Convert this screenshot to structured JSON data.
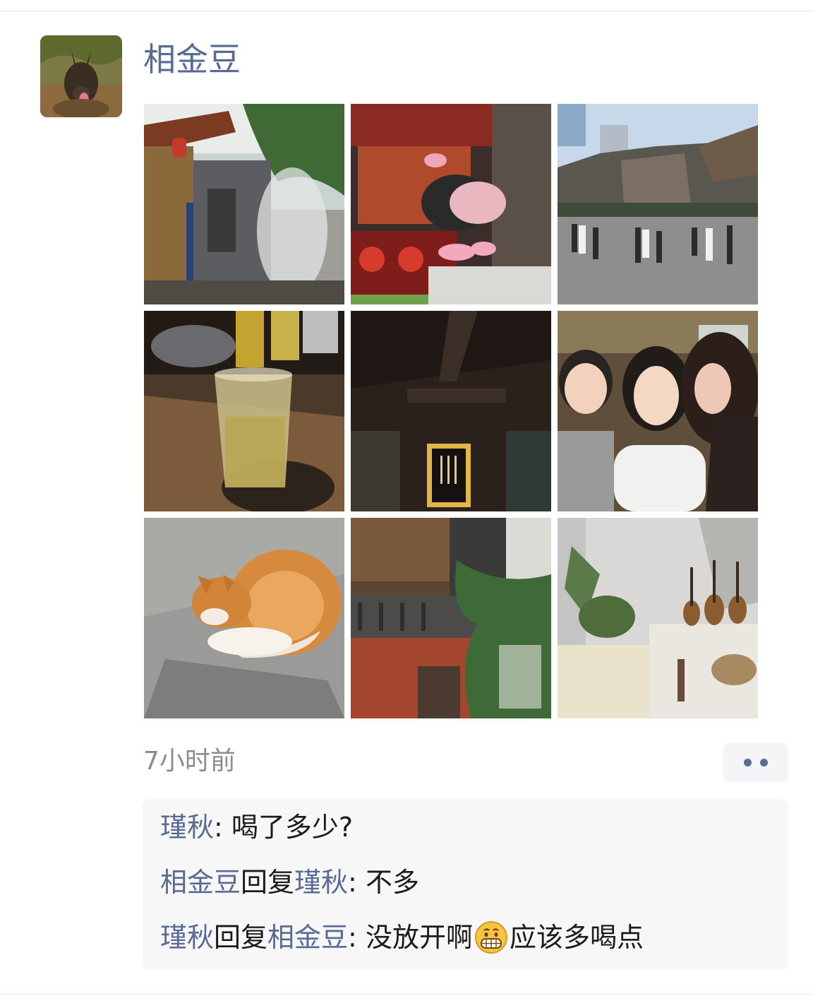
{
  "post": {
    "author": "相金豆",
    "avatar_icon": "dog-avatar-icon",
    "photos": [
      {
        "name": "photo-ancient-street",
        "icon": "ancient-street-image"
      },
      {
        "name": "photo-pig-statue",
        "icon": "pig-statue-image"
      },
      {
        "name": "photo-mountain-town",
        "icon": "mountain-town-image"
      },
      {
        "name": "photo-drink-glass",
        "icon": "drink-glass-image"
      },
      {
        "name": "photo-dark-bar-sign",
        "icon": "bar-sign-image"
      },
      {
        "name": "photo-selfie-group",
        "icon": "selfie-image"
      },
      {
        "name": "photo-sleeping-cat",
        "icon": "cat-image"
      },
      {
        "name": "photo-brick-building",
        "icon": "brick-building-image"
      },
      {
        "name": "photo-room-guitars",
        "icon": "guitar-room-image"
      }
    ],
    "time": "7小时前",
    "more_icon": "ellipsis-icon"
  },
  "comments": [
    {
      "from": "瑾秋",
      "verb": "",
      "to": "",
      "separator": ": ",
      "text_before": "喝了多少?",
      "emoji": "",
      "text_after": ""
    },
    {
      "from": "相金豆",
      "verb": "回复",
      "to": "瑾秋",
      "separator": ": ",
      "text_before": "不多",
      "emoji": "",
      "text_after": ""
    },
    {
      "from": "瑾秋",
      "verb": "回复",
      "to": "相金豆",
      "separator": ": ",
      "text_before": "没放开啊",
      "emoji": "grimace-emoji",
      "text_after": "应该多喝点"
    }
  ],
  "colors": {
    "name_link": "#576b95",
    "time": "#8c8c8c",
    "comment_bg": "#f7f7f7",
    "text": "#1b1b1b"
  }
}
